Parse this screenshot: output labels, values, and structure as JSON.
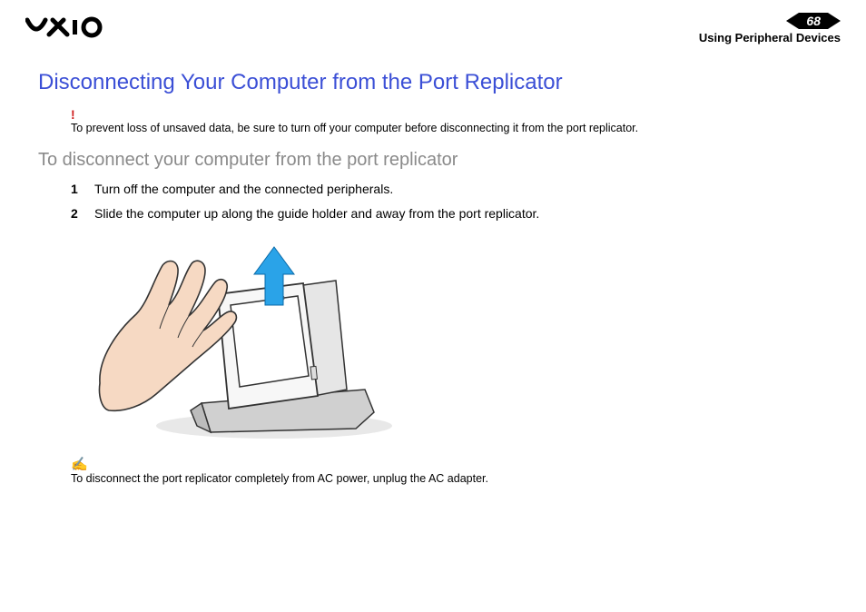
{
  "header": {
    "page_number": "68",
    "section": "Using Peripheral Devices"
  },
  "content": {
    "heading": "Disconnecting Your Computer from the Port Replicator",
    "warning_mark": "!",
    "warning_text": "To prevent loss of unsaved data, be sure to turn off your computer before disconnecting it from the port replicator.",
    "sub_heading": "To disconnect your computer from the port replicator",
    "steps": [
      {
        "num": "1",
        "text": "Turn off the computer and the connected peripherals."
      },
      {
        "num": "2",
        "text": "Slide the computer up along the guide holder and away from the port replicator."
      }
    ],
    "note_mark": "✍",
    "note_text": "To disconnect the port replicator completely from AC power, unplug the AC adapter."
  }
}
